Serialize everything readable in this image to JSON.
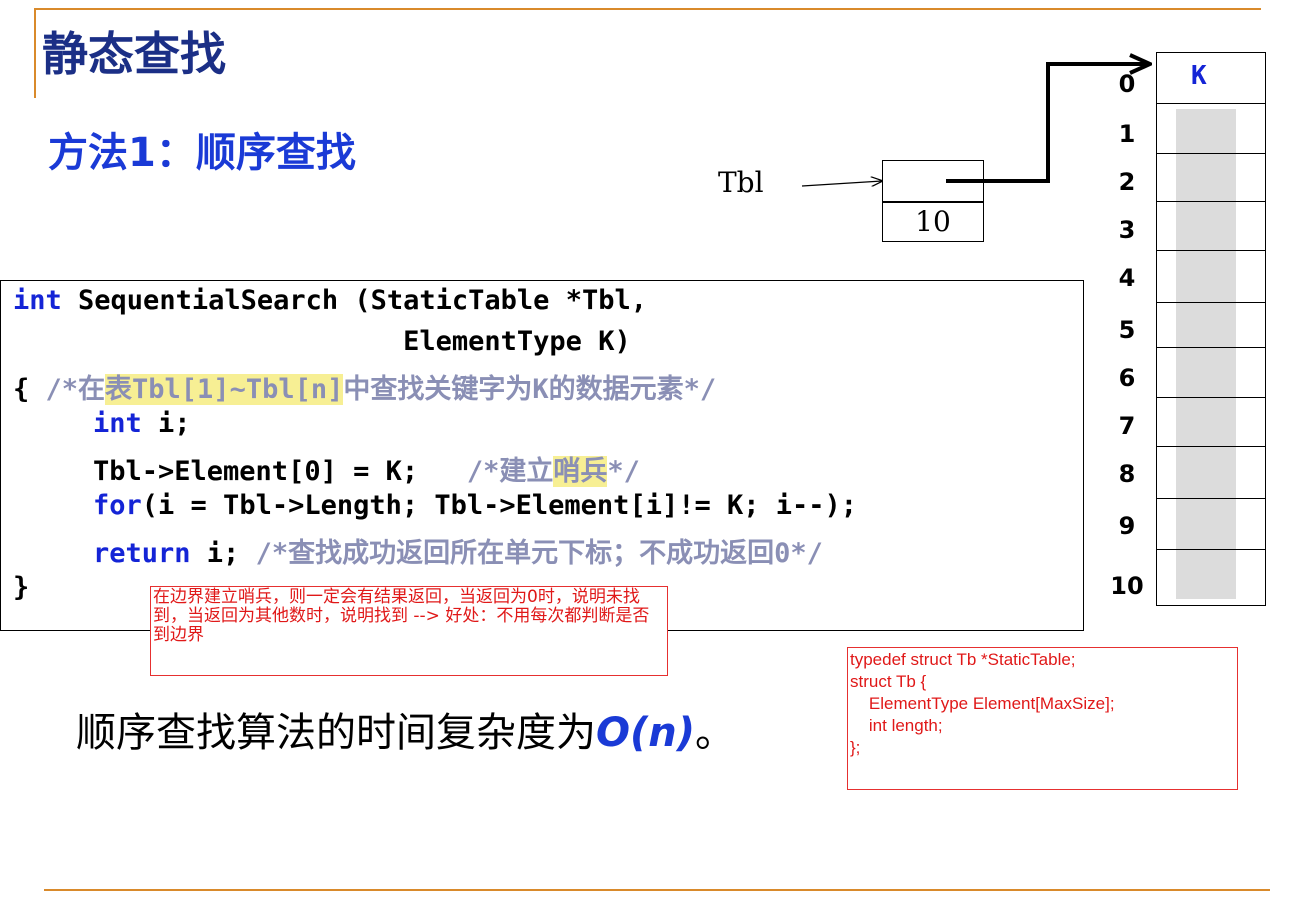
{
  "slide": {
    "title": "静态查找",
    "subtitle": "方法1：顺序查找"
  },
  "diagram": {
    "pointer_label": "Tbl",
    "length_value": "10",
    "array_header": "K",
    "indices": [
      "0",
      "1",
      "2",
      "3",
      "4",
      "5",
      "6",
      "7",
      "8",
      "9",
      "10"
    ]
  },
  "code": {
    "line1_kw": "int",
    "line1_rest": " SequentialSearch (StaticTable *Tbl,",
    "line2": "                        ElementType K)",
    "line3_brace": "{ ",
    "line3_c1": "/*在",
    "line3_c2": "表Tbl[1]~Tbl[n]",
    "line3_c3": "中查找关键字为K的数据元素*/",
    "line4_kw": "int",
    "line4_rest": " i;",
    "line5_code": "Tbl->Element[0] = K;   ",
    "line5_c1": "/*建立",
    "line5_c2": "哨兵",
    "line5_c3": "*/",
    "line6_kw": "for",
    "line6_rest": "(i = Tbl->Length; Tbl->Element[i]!= K; i--);",
    "line7_kw": "return",
    "line7_rest": " i; ",
    "line7_c": "/*查找成功返回所在单元下标；不成功返回0*/",
    "line8": "}"
  },
  "notes": {
    "sentinel_note": "在边界建立哨兵，则一定会有结果返回，当返回为0时，说明未找到，当返回为其他数时，说明找到 --> 好处：不用每次都判断是否到边界",
    "struct_note": "typedef struct Tb *StaticTable;\nstruct Tb {\n    ElementType Element[MaxSize];\n    int length;\n};"
  },
  "complexity": {
    "text": "顺序查找算法的时间复杂度为",
    "bigO": "O(n)",
    "tail": "。"
  },
  "colors": {
    "title": "#1b2f86",
    "accent_blue": "#1a3ad6",
    "keyword": "#1424d6",
    "comment": "#8a8fb5",
    "highlight": "#f7ef94",
    "note_red": "#e01818",
    "rule": "#d98a2b"
  }
}
